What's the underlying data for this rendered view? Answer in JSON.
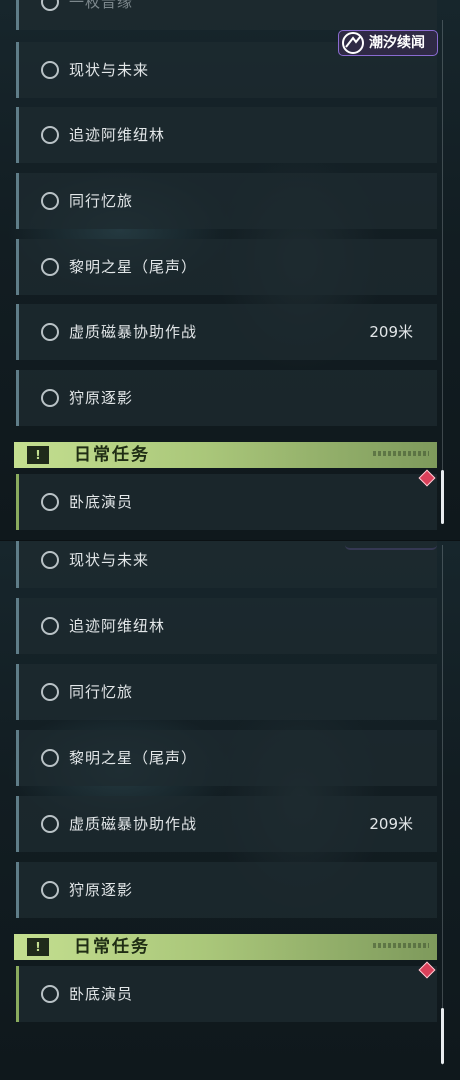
{
  "brand": {
    "label": "潮汐续闻",
    "icon": "tide-logo-icon"
  },
  "colors": {
    "quest_border": "#5f7d88",
    "daily_accent": "#c4df90",
    "alert": "#d9405a"
  },
  "panel_top": {
    "partial_item_label": "一枚音缘",
    "quests": [
      {
        "label": "现状与未来",
        "distance": ""
      },
      {
        "label": "追迹阿维纽林",
        "distance": ""
      },
      {
        "label": "同行忆旅",
        "distance": ""
      },
      {
        "label": "黎明之星（尾声）",
        "distance": ""
      },
      {
        "label": "虚质磁暴协助作战",
        "distance": "209米"
      },
      {
        "label": "狩原逐影",
        "distance": ""
      }
    ],
    "daily_section": {
      "title": "日常任务",
      "icon": "exclamation-icon"
    },
    "daily_quests": [
      {
        "label": "卧底演员"
      }
    ]
  },
  "panel_bottom": {
    "quests": [
      {
        "label": "现状与未来",
        "distance": ""
      },
      {
        "label": "追迹阿维纽林",
        "distance": ""
      },
      {
        "label": "同行忆旅",
        "distance": ""
      },
      {
        "label": "黎明之星（尾声）",
        "distance": ""
      },
      {
        "label": "虚质磁暴协助作战",
        "distance": "209米"
      },
      {
        "label": "狩原逐影",
        "distance": ""
      }
    ],
    "daily_section": {
      "title": "日常任务",
      "icon": "exclamation-icon"
    },
    "daily_quests": [
      {
        "label": "卧底演员"
      }
    ]
  }
}
